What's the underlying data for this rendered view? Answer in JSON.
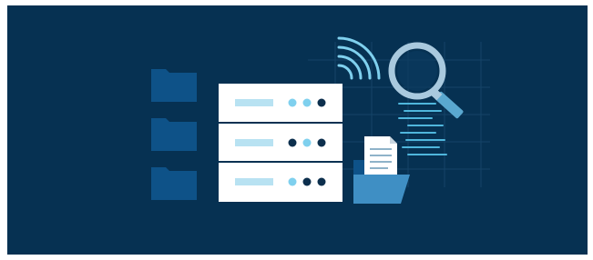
{
  "illustration": {
    "background_color": "#063152",
    "folder_color": "#0e5288",
    "server_color": "#ffffff",
    "accent_light": "#7fd0ee",
    "accent_dark": "#0c2f4d",
    "magnifier_color": "#a9c9de",
    "server_rows": [
      {
        "dots": [
          "light",
          "light",
          "dark"
        ]
      },
      {
        "dots": [
          "dark",
          "light",
          "dark"
        ]
      },
      {
        "dots": [
          "light",
          "dark",
          "dark"
        ]
      }
    ],
    "icons": [
      "folder-icon",
      "folder-icon",
      "folder-icon",
      "server-rack-icon",
      "wifi-signal-icon",
      "magnifier-icon",
      "document-icon",
      "open-folder-icon"
    ]
  }
}
